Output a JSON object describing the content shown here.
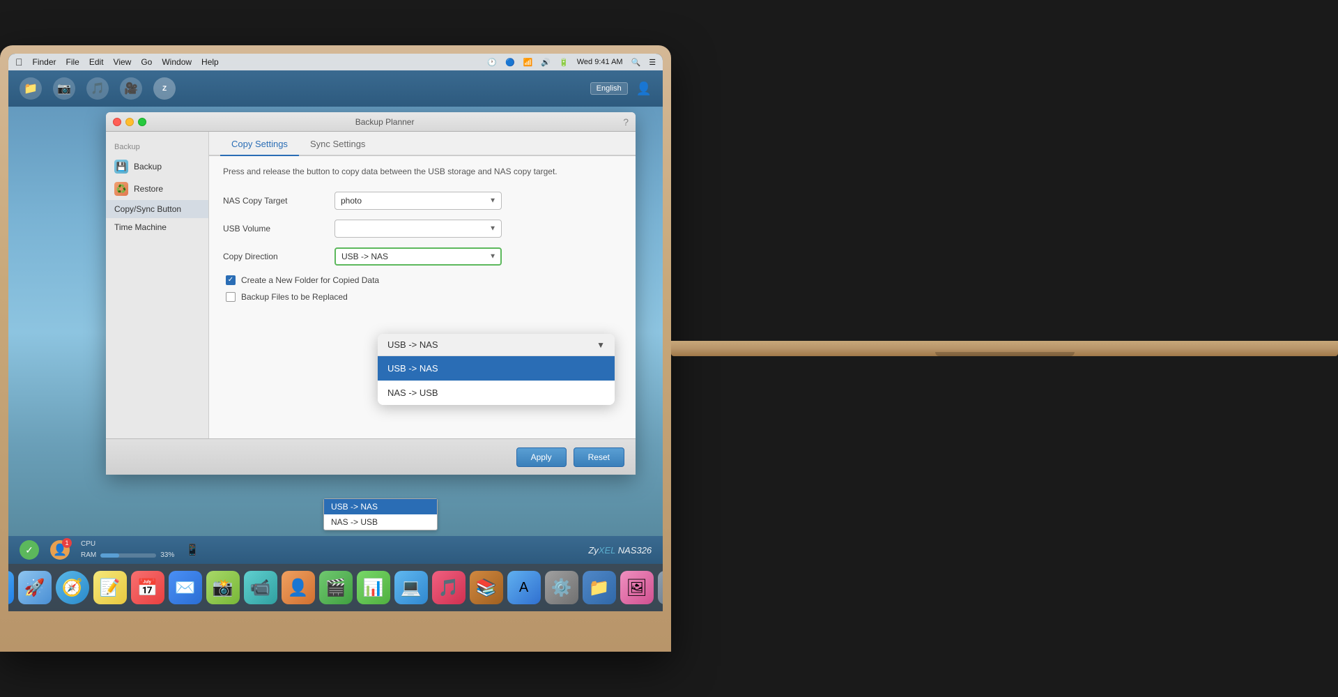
{
  "menubar": {
    "apple": "",
    "items": [
      "Finder",
      "File",
      "Edit",
      "View",
      "Go",
      "Window",
      "Help"
    ],
    "right_items": [
      "Wed 9:41 AM"
    ],
    "time": "Wed 9:41 AM"
  },
  "nas_topbar": {
    "language": "English",
    "icons": [
      "📁",
      "📷",
      "🎵",
      "🎥"
    ]
  },
  "window": {
    "title": "Backup Planner",
    "tabs": [
      {
        "label": "Copy Settings",
        "active": true
      },
      {
        "label": "Sync Settings",
        "active": false
      }
    ],
    "description": "Press and release the button to copy data between the USB storage and NAS copy target.",
    "fields": {
      "nas_copy_target": {
        "label": "NAS Copy Target",
        "value": "photo"
      },
      "usb_volume": {
        "label": "USB Volume",
        "value": ""
      },
      "copy_direction": {
        "label": "Copy Direction",
        "value": "USB -> NAS"
      }
    },
    "checkboxes": [
      {
        "label": "Create a New Folder for Copied Data",
        "checked": true
      },
      {
        "label": "Backup Files to be Replaced",
        "checked": false
      }
    ],
    "buttons": {
      "apply": "Apply",
      "reset": "Reset"
    }
  },
  "sidebar": {
    "section": "Backup",
    "items": [
      {
        "label": "Backup",
        "icon": "backup"
      },
      {
        "label": "Restore",
        "icon": "restore"
      }
    ],
    "copy_sync": "Copy/Sync Button",
    "time_machine": "Time Machine"
  },
  "dropdown": {
    "header": "USB -> NAS",
    "options": [
      {
        "label": "USB -> NAS",
        "selected": true
      },
      {
        "label": "NAS -> USB",
        "selected": false
      }
    ]
  },
  "inline_dropdown": {
    "options": [
      {
        "label": "USB -> NAS",
        "selected": true
      },
      {
        "label": "NAS -> USB",
        "selected": false
      }
    ]
  },
  "status": {
    "cpu_label": "CPU",
    "ram_label": "RAM",
    "ram_percent": "33%",
    "ram_fill_width": "33",
    "brand": "ZyXEL NAS326",
    "brand_color": "NAS326"
  },
  "dock": {
    "items": [
      {
        "label": "Finder",
        "emoji": "🗂",
        "class": "dock-finder"
      },
      {
        "label": "Launchpad",
        "emoji": "🚀",
        "class": "dock-launchpad"
      },
      {
        "label": "Safari",
        "emoji": "🧭",
        "class": "dock-safari"
      },
      {
        "label": "Notes",
        "emoji": "📝",
        "class": "dock-notes"
      },
      {
        "label": "Calendar",
        "emoji": "📅",
        "class": "dock-calendar"
      },
      {
        "label": "Mail",
        "emoji": "✉️",
        "class": "dock-mail"
      },
      {
        "label": "Photos2",
        "emoji": "📸",
        "class": "dock-photos2"
      },
      {
        "label": "FaceTime",
        "emoji": "📹",
        "class": "dock-face"
      },
      {
        "label": "Contacts",
        "emoji": "👤",
        "class": "dock-contacts"
      },
      {
        "label": "iMovie",
        "emoji": "🎬",
        "class": "dock-imovie"
      },
      {
        "label": "Numbers",
        "emoji": "📊",
        "class": "dock-numbers"
      },
      {
        "label": "Migration",
        "emoji": "💻",
        "class": "dock-migration"
      },
      {
        "label": "Music",
        "emoji": "🎵",
        "class": "dock-music"
      },
      {
        "label": "iBooks",
        "emoji": "📚",
        "class": "dock-ibooks"
      },
      {
        "label": "AppStore",
        "emoji": "🅰",
        "class": "dock-appstore"
      },
      {
        "label": "SystemPrefs",
        "emoji": "⚙️",
        "class": "dock-syspref"
      },
      {
        "label": "Files",
        "emoji": "📁",
        "class": "dock-files"
      },
      {
        "label": "Photos",
        "emoji": "🖼",
        "class": "dock-photos"
      },
      {
        "label": "Trash",
        "emoji": "🗑",
        "class": "dock-trash"
      }
    ]
  }
}
